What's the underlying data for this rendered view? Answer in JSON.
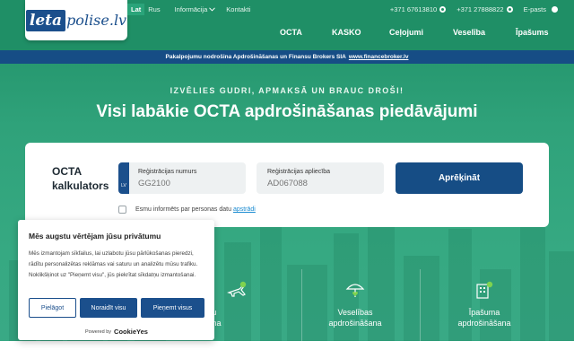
{
  "brand": {
    "logo_part1": "leta",
    "logo_part2": "polise.lv"
  },
  "topbar": {
    "languages": [
      "Lat",
      "Rus"
    ],
    "links": [
      "Informācija",
      "Kontakti"
    ],
    "phones": [
      "+371 67613810",
      "+371 27888822"
    ],
    "email_label": "E-pasts"
  },
  "nav": {
    "items": [
      "OCTA",
      "KASKO",
      "Ceļojumi",
      "Veselība",
      "Īpašums"
    ]
  },
  "infobar": {
    "text": "Pakalpojumu nodrošina Apdrošināšanas un Finansu Brokers SIA",
    "link": "www.financebroker.lv"
  },
  "hero": {
    "tagline": "IZVĒLIES GUDRI, APMAKSĀ UN BRAUC DROŠI!",
    "headline": "Visi labākie OCTA apdrošināšanas piedāvājumi"
  },
  "calculator": {
    "title": "OCTA kalkulators",
    "plate_flag": "LV",
    "reg_number_label": "Reģistrācijas numurs",
    "reg_number_placeholder": "GG2100",
    "reg_cert_label": "Reģistrācijas apliecība",
    "reg_cert_placeholder": "AD067088",
    "submit_label": "Aprēķināt",
    "consent_text": "Esmu informēts par personas datu",
    "consent_link": "apstrādi"
  },
  "tiles": [
    {
      "line1": "…ojumu",
      "line2": "…nāšana"
    },
    {
      "line1": "Veselības",
      "line2": "apdrošināšana"
    },
    {
      "line1": "Īpašuma",
      "line2": "apdrošināšana"
    }
  ],
  "cookie": {
    "title": "Mēs augstu vērtējam jūsu privātumu",
    "text": "Mēs izmantojam sīkfailus, lai uzlabotu jūsu pārlūkošanas pieredzi, rādītu personalizētas reklāmas vai saturu un analizētu mūsu trafiku. Noklikšķinot uz \"Pieņemt visu\", jūs piekrītat sīkdatņu izmantošanai.",
    "btn_customize": "Pielāgot",
    "btn_reject": "Noraidīt visu",
    "btn_accept": "Pieņemt visus",
    "powered_by": "Powered by",
    "powered_brand": "CookieYes"
  },
  "colors": {
    "green": "#1f8f66",
    "navy": "#164d85",
    "link": "#1a8bd1"
  }
}
